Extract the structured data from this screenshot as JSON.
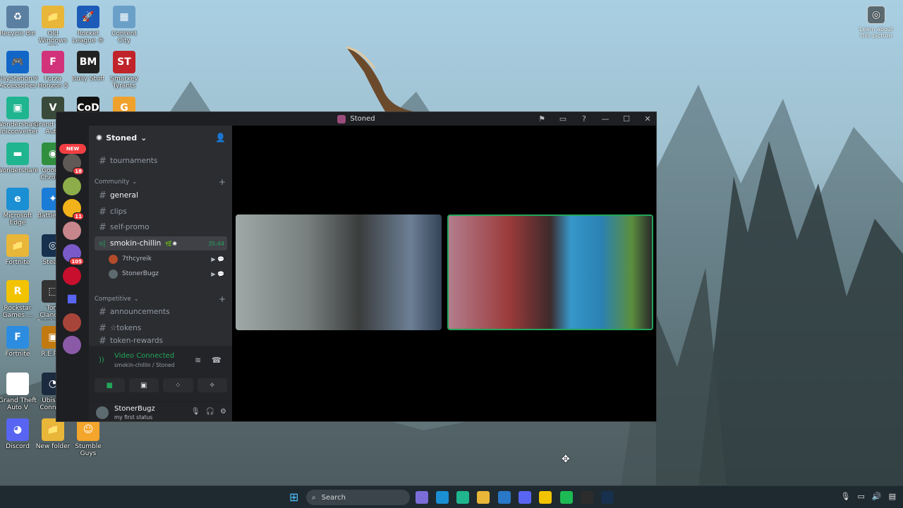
{
  "desktop": {
    "icons": [
      {
        "label": "Recycle Bin",
        "glyph": "♻",
        "color": "#5a7fa0"
      },
      {
        "label": "Old Windows (D)",
        "glyph": "📁",
        "color": "#e8b638"
      },
      {
        "label": "Rocket League ®",
        "glyph": "🚀",
        "color": "#1d5bb8"
      },
      {
        "label": "Content City",
        "glyph": "▦",
        "color": "#6aa0c8"
      },
      {
        "label": "PlayStation® Accessories",
        "glyph": "🎮",
        "color": "#1266c8"
      },
      {
        "label": "Forza Horizon 5",
        "glyph": "F",
        "color": "#d2327a"
      },
      {
        "label": "Bully Stuff",
        "glyph": "BM",
        "color": "#222222"
      },
      {
        "label": "Smarkey Tyrants",
        "glyph": "ST",
        "color": "#c0242a"
      },
      {
        "label": "Wondershare Uniconverter",
        "glyph": "▣",
        "color": "#1fb58f"
      },
      {
        "label": "Grand Theft Auto",
        "glyph": "V",
        "color": "#3a4a3a"
      },
      {
        "label": "Call of Duty",
        "glyph": "CoD",
        "color": "#111111"
      },
      {
        "label": "G Hub",
        "glyph": "G",
        "color": "#f0a12b"
      },
      {
        "label": "Wondershare",
        "glyph": "▬",
        "color": "#1fb58f"
      },
      {
        "label": "Google Chrome",
        "glyph": "◉",
        "color": "#2f8f3f"
      },
      {
        "label": "Microsoft Edge",
        "glyph": "e",
        "color": "#1a8fd3"
      },
      {
        "label": "Battle.net",
        "glyph": "✦",
        "color": "#1a7cd6"
      },
      {
        "label": "Fortnite",
        "glyph": "📁",
        "color": "#e8b638"
      },
      {
        "label": "Steam",
        "glyph": "◎",
        "color": "#16304d"
      },
      {
        "label": "Rockstar Games ...",
        "glyph": "R",
        "color": "#f2c300"
      },
      {
        "label": "Tom Clancy's Rainbow...",
        "glyph": "⬚",
        "color": "#333333"
      },
      {
        "label": "Fortnite",
        "glyph": "F",
        "color": "#2c8de0"
      },
      {
        "label": "R.E.P.O.",
        "glyph": "▣",
        "color": "#c27a10"
      },
      {
        "label": "Grand Theft Auto V",
        "glyph": "▯",
        "color": "#ffffff"
      },
      {
        "label": "Ubisoft Connect",
        "glyph": "◔",
        "color": "#1b2a3f"
      },
      {
        "label": "Discord",
        "glyph": "◕",
        "color": "#5865f2"
      },
      {
        "label": "New folder",
        "glyph": "📁",
        "color": "#e8b638"
      },
      {
        "label": "Stumble Guys",
        "glyph": "☺",
        "color": "#f4a52b"
      }
    ],
    "learn_label": "Learn about this picture"
  },
  "window": {
    "title": "Stoned",
    "controls": [
      "⚑",
      "▭",
      "?",
      "—",
      "☐",
      "✕"
    ]
  },
  "guilds": {
    "new_label": "NEW",
    "items": [
      {
        "color": "#5f5a55",
        "badge": "18"
      },
      {
        "color": "#8cad4a",
        "badge": ""
      },
      {
        "color": "#f1b21a",
        "badge": "11"
      },
      {
        "color": "#c6868c",
        "badge": ""
      },
      {
        "color": "#7a5ac8",
        "badge": "105"
      },
      {
        "color": "#c8102e",
        "badge": ""
      },
      {
        "color": "#5865f2",
        "badge": ""
      },
      {
        "color": "#a8453b",
        "badge": ""
      },
      {
        "color": "#8a5aa8",
        "badge": ""
      }
    ]
  },
  "server": {
    "name": "Stoned",
    "channels_top": [
      {
        "name": "tournaments"
      }
    ],
    "category_community": "Community",
    "community_channels": [
      {
        "name": "general",
        "state": "unread"
      },
      {
        "name": "clips",
        "state": "normal"
      },
      {
        "name": "self-promo",
        "state": "normal"
      }
    ],
    "voice_channel": {
      "name": "smokin-chillin",
      "timer": "35:44"
    },
    "voice_users": [
      {
        "name": "7thcyreik",
        "color": "#b34a2a"
      },
      {
        "name": "StonerBugz",
        "color": "#5d6a6f"
      }
    ],
    "category_competitive": "Competitive",
    "competitive_channels": [
      {
        "name": "announcements"
      },
      {
        "name": "☆tokens"
      },
      {
        "name": "token-rewards"
      }
    ]
  },
  "voice_panel": {
    "status": "Video Connected",
    "sub": "smokin-chillin / Stoned"
  },
  "user_panel": {
    "name": "StonerBugz",
    "status": "my first status"
  },
  "taskbar": {
    "search_placeholder": "Search",
    "apps": [
      {
        "name": "copilot",
        "color": "#7b6dd8"
      },
      {
        "name": "edge",
        "color": "#1a8fd3"
      },
      {
        "name": "wondershare",
        "color": "#1fb58f"
      },
      {
        "name": "file-explorer",
        "color": "#e8b638"
      },
      {
        "name": "store",
        "color": "#2a78c8"
      },
      {
        "name": "discord",
        "color": "#5865f2"
      },
      {
        "name": "rockstar",
        "color": "#f2c300"
      },
      {
        "name": "spotify",
        "color": "#1db954"
      },
      {
        "name": "epic",
        "color": "#2c2c2c"
      },
      {
        "name": "steam",
        "color": "#16304d"
      }
    ]
  }
}
